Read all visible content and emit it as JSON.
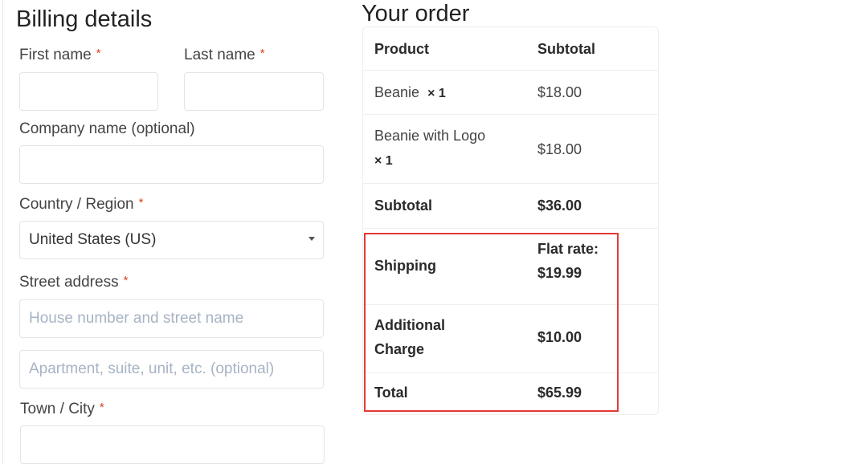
{
  "billing": {
    "title": "Billing details",
    "required_marker": "*",
    "fields": {
      "first_name": {
        "label": "First name",
        "value": ""
      },
      "last_name": {
        "label": "Last name",
        "value": ""
      },
      "company": {
        "label": "Company name (optional)",
        "value": ""
      },
      "country": {
        "label": "Country / Region",
        "value": "United States (US)"
      },
      "street": {
        "label": "Street address",
        "placeholder_1": "House number and street name",
        "placeholder_2": "Apartment, suite, unit, etc. (optional)"
      },
      "city": {
        "label": "Town / City",
        "value": ""
      }
    }
  },
  "order": {
    "title": "Your order",
    "headers": {
      "product": "Product",
      "subtotal": "Subtotal"
    },
    "items": [
      {
        "name": "Beanie",
        "qty": "× 1",
        "price": "$18.00"
      },
      {
        "name": "Beanie with Logo",
        "qty": "× 1",
        "price": "$18.00"
      }
    ],
    "subtotal": {
      "label": "Subtotal",
      "value": "$36.00"
    },
    "shipping": {
      "label": "Shipping",
      "method": "Flat rate:",
      "value": "$19.99"
    },
    "additional": {
      "label_1": "Additional",
      "label_2": "Charge",
      "value": "$10.00"
    },
    "total": {
      "label": "Total",
      "value": "$65.99"
    },
    "highlight_color": "#e53935"
  }
}
